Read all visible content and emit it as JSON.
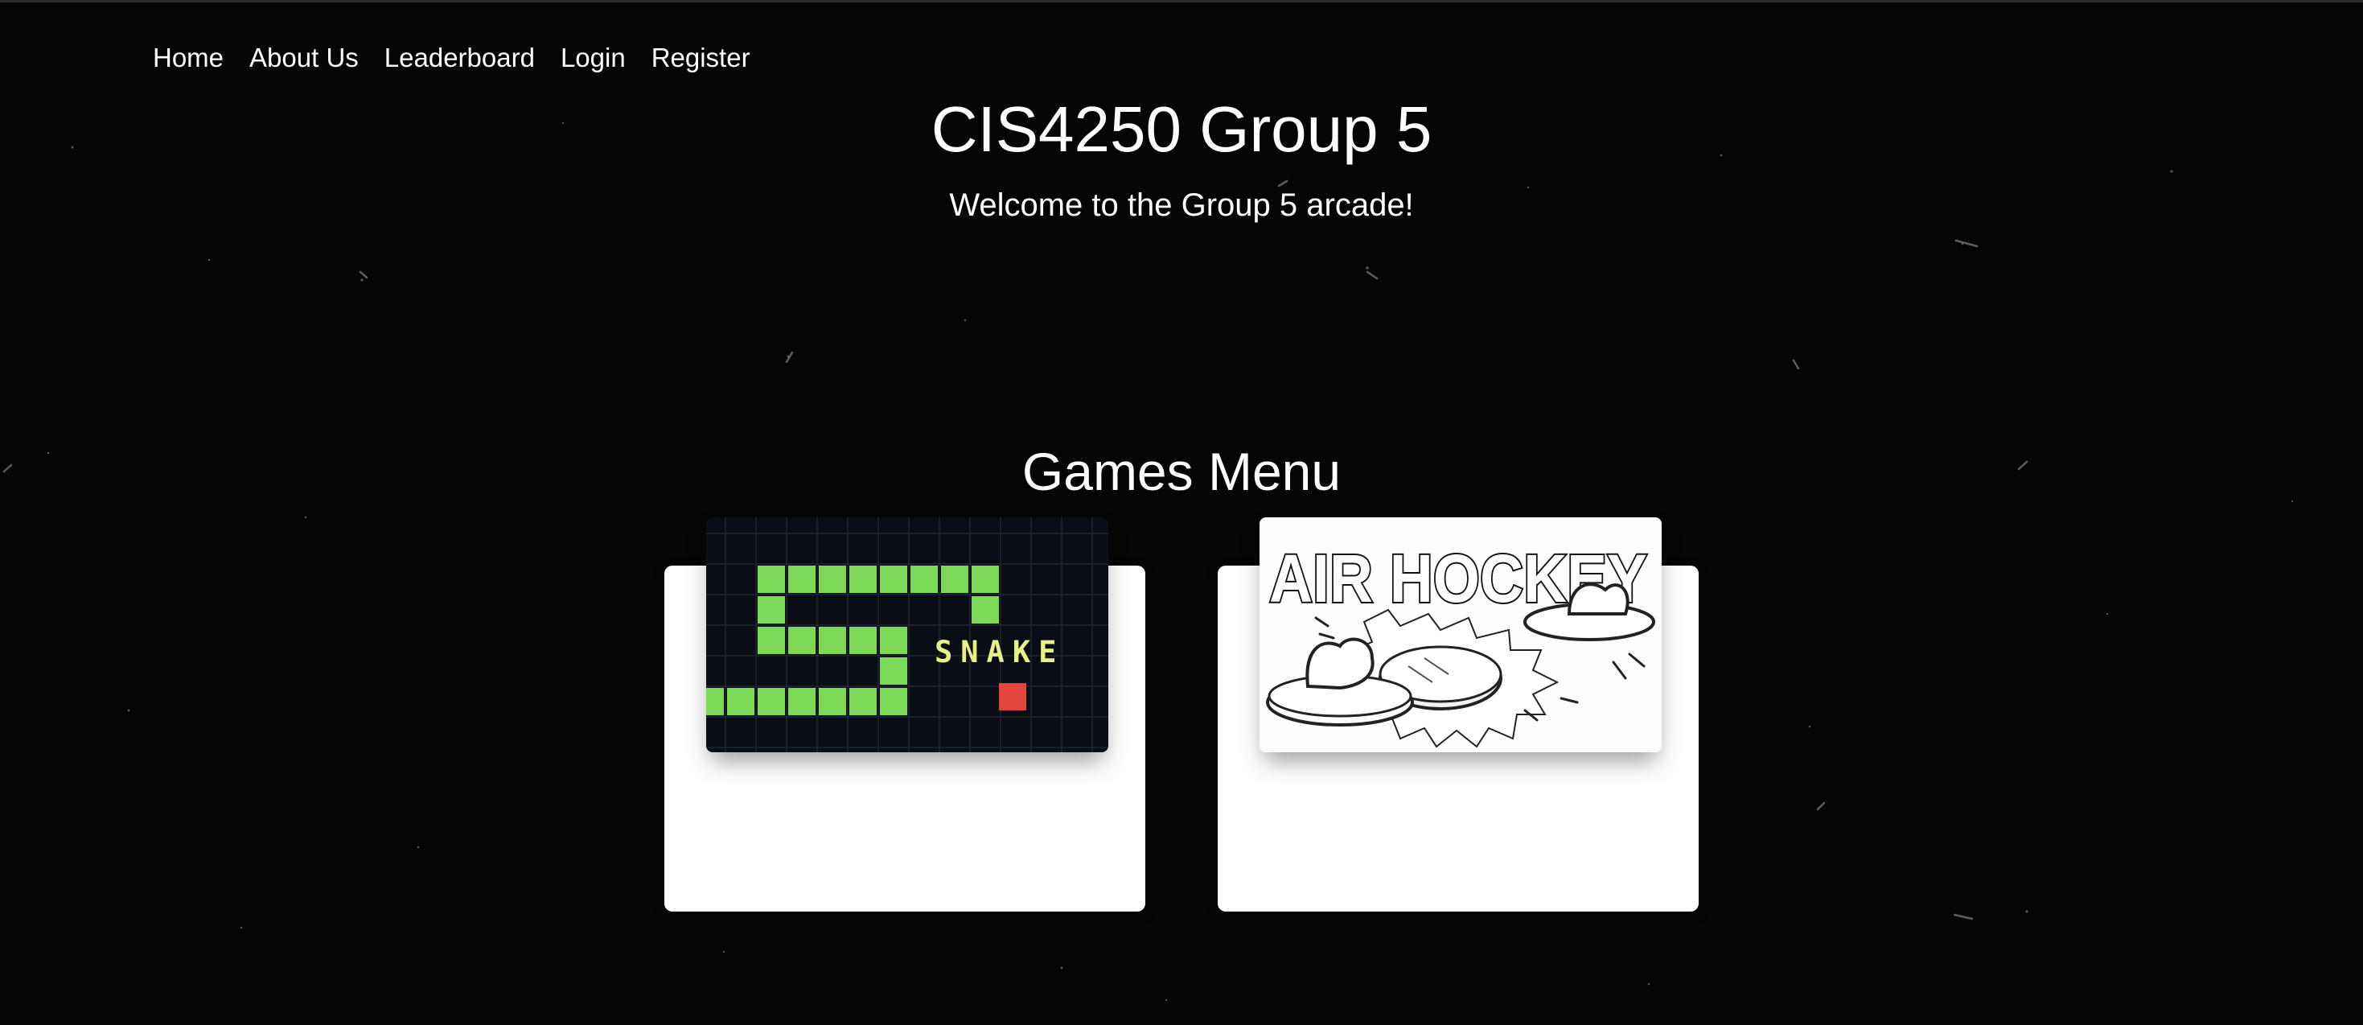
{
  "nav": {
    "items": [
      "Home",
      "About Us",
      "Leaderboard",
      "Login",
      "Register"
    ]
  },
  "header": {
    "title": "CIS4250 Group 5",
    "subtitle": "Welcome to the Group 5 arcade!"
  },
  "games_menu": {
    "title": "Games Menu",
    "games": [
      {
        "name": "snake",
        "image_text": "SNAKE",
        "icon": "snake-game-thumbnail",
        "colors": {
          "snake": "#7ed957",
          "food": "#e0463c",
          "background": "#0a0e14"
        }
      },
      {
        "name": "air-hockey",
        "image_text": "AIR HOCKEY",
        "icon": "air-hockey-game-thumbnail"
      }
    ]
  },
  "colors": {
    "background": "#050505",
    "text": "#ffffff",
    "card": "#ffffff"
  }
}
